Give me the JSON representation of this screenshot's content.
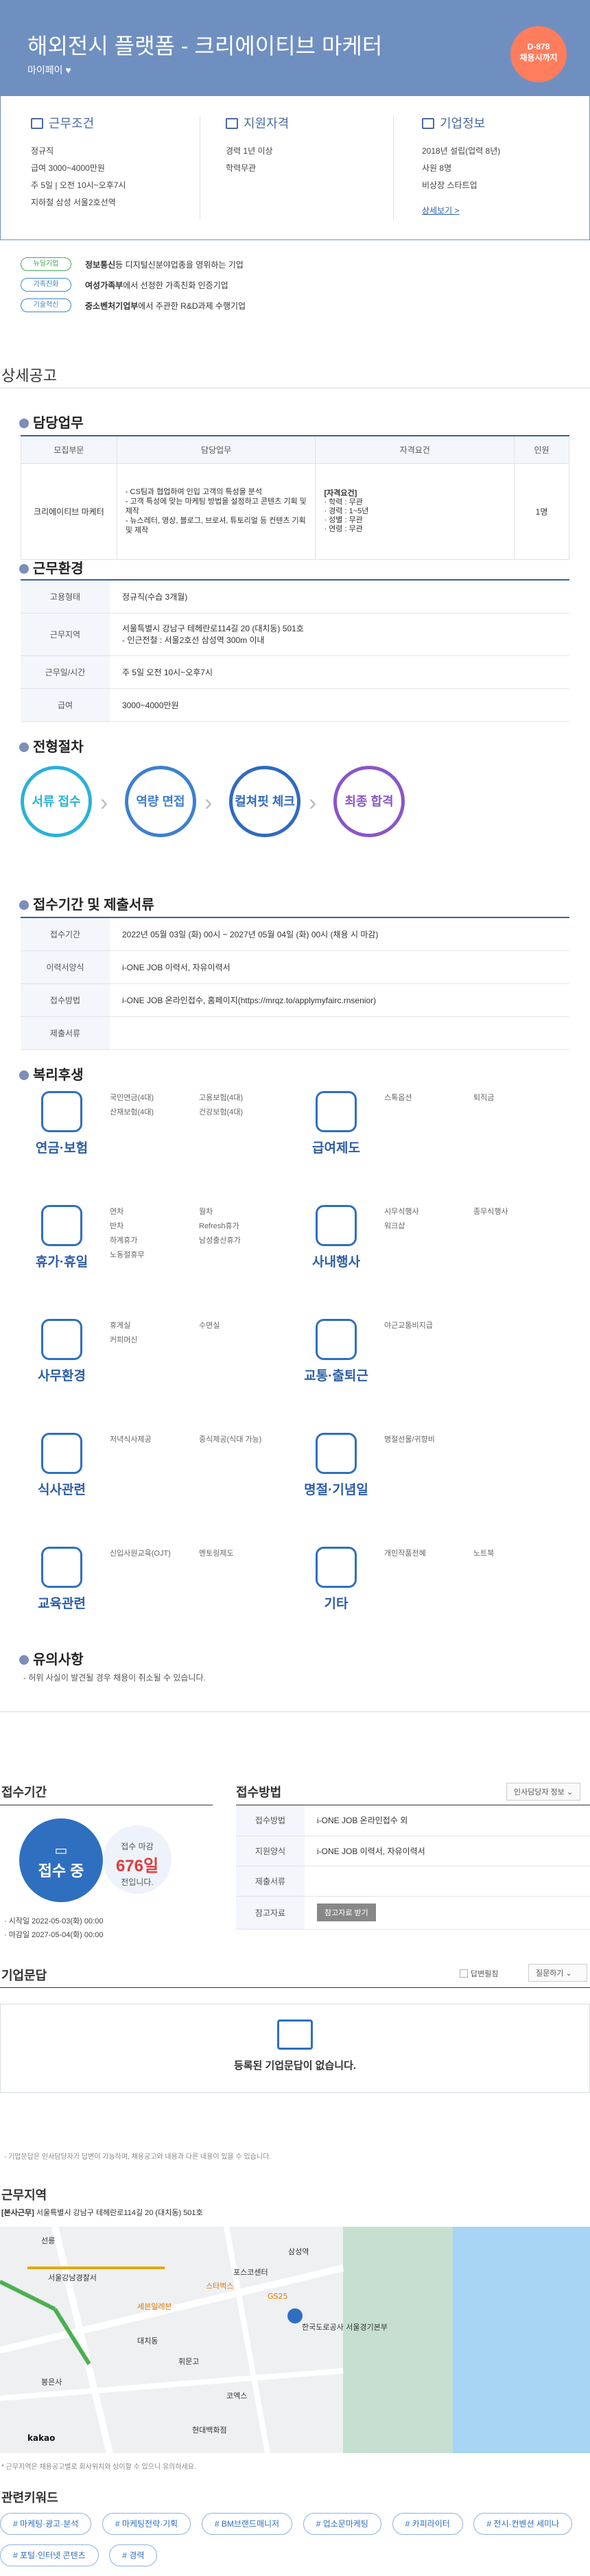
{
  "header": {
    "title": "해외전시 플랫폼 - 크리에이티브 마케터",
    "company": "마이페이",
    "dday": "D-878",
    "dday_sub": "채용시까지"
  },
  "summary": {
    "conditions": {
      "title": "근무조건",
      "lines": [
        "정규직",
        "급여 3000~4000만원",
        "주 5일 | 오전 10시~오후7시",
        "지하철 삼성 서울2호선역"
      ]
    },
    "qualifications": {
      "title": "지원자격",
      "lines": [
        "경력 1년 이상",
        "학력무관"
      ]
    },
    "company_info": {
      "title": "기업정보",
      "lines": [
        "2018년 설립(업력 8년)",
        "사원 8명",
        "비상장 스타트업"
      ],
      "link": "상세보기 >"
    }
  },
  "tags": [
    {
      "badge": "뉴딜기업",
      "text_bold": "정보통신",
      "text": "등 디지털신분야업종을 영위하는 기업"
    },
    {
      "badge": "가족친화",
      "text_bold": "여성가족부",
      "text": "에서 선정한 가족친화 인증기업"
    },
    {
      "badge": "기술혁신",
      "text_bold": "중소벤처기업부",
      "text": "에서 주관한 R&D과제 수행기업"
    }
  ],
  "detail_title": "상세공고",
  "duties": {
    "title": "담당업무",
    "headers": [
      "모집부문",
      "담당업무",
      "자격요건",
      "인원"
    ],
    "row": {
      "dept": "크리에이티브 마케터",
      "tasks": [
        "- CS팀과 협업하여 인입 고객의 특성을 분석",
        "- 고객 특성에 맞는 마케팅 방법을 설정하고 콘텐츠 기획 및 제작",
        "- 뉴스레터, 영상, 블로그, 브로셔, 튜토리얼 등 컨텐츠 기획 및 제작"
      ],
      "reqs": [
        "[자격요건]",
        "· 학력 : 무관",
        "· 경력 : 1~5년",
        "· 성별 : 무관",
        "· 연령 : 무관"
      ],
      "count": "1명"
    }
  },
  "environment": {
    "title": "근무환경",
    "rows": [
      {
        "label": "고용형태",
        "value": "정규직(수습 3개월)"
      },
      {
        "label": "근무지역",
        "value": "서울특별시 강남구 테헤란로114길 20 (대치동) 501호",
        "value2": "- 인근전철 : 서울2호선 삼성역 300m 이내"
      },
      {
        "label": "근무일/시간",
        "value": "주 5일 오전 10시~오후7시"
      },
      {
        "label": "급여",
        "value": "3000~4000만원"
      }
    ]
  },
  "process": {
    "title": "전형절차",
    "steps": [
      "서류 접수",
      "역량 면접",
      "컬쳐핏 체크",
      "최종 합격"
    ],
    "colors": [
      "#2bb1d9",
      "#3d7fd1",
      "#2f6ac0",
      "#8a55c9"
    ]
  },
  "application": {
    "title": "접수기간 및 제출서류",
    "rows": [
      {
        "label": "접수기간",
        "value": "2022년 05월 03일 (화) 00시 ~ 2027년 05월 04일 (화) 00시 (채용 시 마감)"
      },
      {
        "label": "이력서양식",
        "value": "i-ONE JOB 이력서, 자유이력서"
      },
      {
        "label": "접수방법",
        "value": "i-ONE JOB 온라인접수, 홈페이지(https://mrqz.to/applymyfairc.rnsenior)"
      },
      {
        "label": "제출서류",
        "value": ""
      }
    ]
  },
  "benefits": {
    "title": "복리후생",
    "categories": [
      {
        "name": "연금·보험",
        "items": [
          "국민연금(4대)",
          "고용보험(4대)",
          "산재보험(4대)",
          "건강보험(4대)"
        ]
      },
      {
        "name": "급여제도",
        "items": [
          "스톡옵션",
          "퇴직금"
        ]
      },
      {
        "name": "휴가·휴일",
        "items": [
          "연차",
          "월차",
          "반차",
          "Refresh휴가",
          "하계휴가",
          "남성출산휴가",
          "노동절휴무"
        ]
      },
      {
        "name": "사내행사",
        "items": [
          "시무식행사",
          "종무식행사",
          "워크샵"
        ]
      },
      {
        "name": "사무환경",
        "items": [
          "휴게실",
          "수면실",
          "커피머신"
        ]
      },
      {
        "name": "교통·출퇴근",
        "items": [
          "야근교통비지급"
        ]
      },
      {
        "name": "식사관련",
        "items": [
          "저녁식사제공",
          "중식제공(식대 가능)"
        ]
      },
      {
        "name": "명절·기념일",
        "items": [
          "명절선물/귀향비"
        ]
      },
      {
        "name": "교육관련",
        "items": [
          "신입사원교육(OJT)",
          "멘토링제도"
        ]
      },
      {
        "name": "기타",
        "items": [
          "개인작품전혜",
          "노트북"
        ]
      }
    ]
  },
  "caution": {
    "title": "유의사항",
    "text": "- 허위 사실이 발견될 경우 채용이 취소될 수 있습니다."
  },
  "apply_period": {
    "title": "접수기간",
    "status": "접수 중",
    "deadline_label": "접수 마감",
    "remain": "676일",
    "remain_sub": "전입니다.",
    "start": "· 시작일 2022-05-03(화) 00:00",
    "end": "· 마감일 2027-05-04(화) 00:00"
  },
  "apply_method": {
    "title": "접수방법",
    "contact_btn": "인사담당자 정보 ⌄",
    "rows": [
      {
        "label": "접수방법",
        "value": "i-ONE JOB 온라인접수 외"
      },
      {
        "label": "지원양식",
        "value": "i-ONE JOB 이력서, 자유이력서"
      },
      {
        "label": "제출서류",
        "value": ""
      },
      {
        "label": "참고자료",
        "value": "참고자료 받기"
      }
    ]
  },
  "qna": {
    "title": "기업문답",
    "checkbox": "답변필침",
    "select": "질문하기",
    "empty": "등록된 기업문답이 없습니다.",
    "note": "- 기업문답은 인사담당자가 답변이 가능하며, 채용공고와 내용과 다른 내용이 있을 수 있습니다."
  },
  "location": {
    "title": "근무지역",
    "address_label": "[본사근무]",
    "address": "서울특별시 강남구 테헤란로114길 20 (대치동) 501호",
    "note": "* 근무지역은 채용공고별로 회사위치와 상이할 수 있으니 유의하세요.",
    "map_labels": [
      "선릉",
      "서울강남경찰서",
      "포스코센터",
      "스타벅스",
      "대치동",
      "삼성역",
      "한국도로공사 서울경기본부",
      "kakao",
      "휘문고",
      "세븐일레븐",
      "GS25",
      "코엑스",
      "봉은사",
      "현대백화점"
    ]
  },
  "keywords": {
    "title": "관련키워드",
    "items": [
      "# 마케팅·광고·분석",
      "# 마케팅전략·기획",
      "# BM브랜드매니저",
      "# 업소문마케팅",
      "# 카피라이터",
      "# 전시·컨벤션 세미나",
      "# 포털·인터넷 콘텐츠",
      "# 경력"
    ]
  }
}
